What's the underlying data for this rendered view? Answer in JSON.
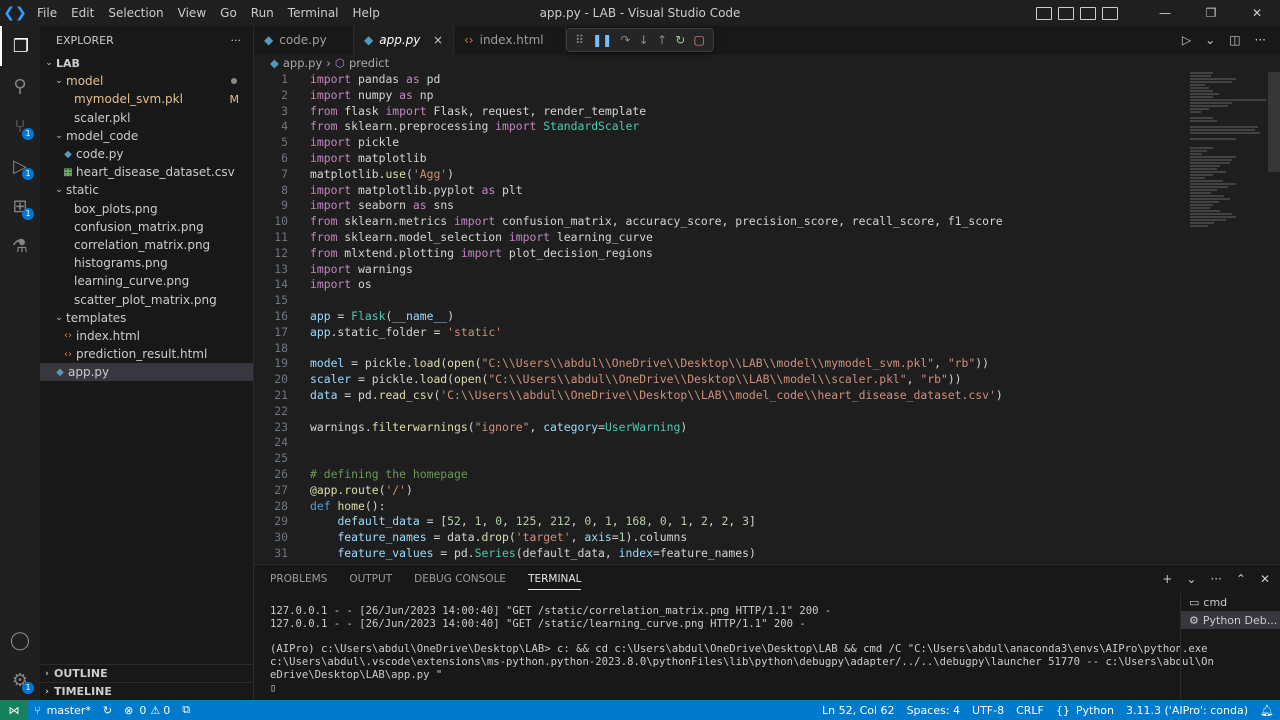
{
  "titlebar": {
    "menu": [
      "File",
      "Edit",
      "Selection",
      "View",
      "Go",
      "Run",
      "Terminal",
      "Help"
    ],
    "title": "app.py - LAB - Visual Studio Code",
    "minimize": "—",
    "maximize": "❐",
    "close": "✕"
  },
  "activity": {
    "scm_badge": "1",
    "debug_badge": "1",
    "ext_badge": "1",
    "settings_badge": "1"
  },
  "explorer": {
    "header": "EXPLORER",
    "more": "···",
    "root": "LAB",
    "folder_model": "model",
    "file_mymodel": "mymodel_svm.pkl",
    "mymodel_status": "M",
    "file_scaler": "scaler.pkl",
    "folder_model_code": "model_code",
    "file_code": "code.py",
    "file_csv": "heart_disease_dataset.csv",
    "folder_static": "static",
    "file_box": "box_plots.png",
    "file_confusion": "confusion_matrix.png",
    "file_correlation": "correlation_matrix.png",
    "file_histograms": "histograms.png",
    "file_learning": "learning_curve.png",
    "file_scatter": "scatter_plot_matrix.png",
    "folder_templates": "templates",
    "file_index": "index.html",
    "file_prediction": "prediction_result.html",
    "file_app": "app.py",
    "outline": "OUTLINE",
    "timeline": "TIMELINE"
  },
  "tabs": {
    "tab1": "code.py",
    "tab2": "app.py",
    "tab3": "index.html",
    "close": "×"
  },
  "breadcrumb": {
    "file": "app.py",
    "symbol": "predict"
  },
  "editor": {
    "lines": [
      {
        "n": "1",
        "h": "<span class='kw'>import</span> pandas <span class='kw'>as</span> pd"
      },
      {
        "n": "2",
        "h": "<span class='kw'>import</span> numpy <span class='kw'>as</span> np"
      },
      {
        "n": "3",
        "h": "<span class='kw'>from</span> flask <span class='kw'>import</span> Flask, request, render_template"
      },
      {
        "n": "4",
        "h": "<span class='kw'>from</span> sklearn.preprocessing <span class='kw'>import</span> <span class='cls'>StandardScaler</span>"
      },
      {
        "n": "5",
        "h": "<span class='kw'>import</span> pickle"
      },
      {
        "n": "6",
        "h": "<span class='kw'>import</span> matplotlib"
      },
      {
        "n": "7",
        "h": "matplotlib.<span class='fn'>use</span>(<span class='str'>'Agg'</span>)"
      },
      {
        "n": "8",
        "h": "<span class='kw'>import</span> matplotlib.pyplot <span class='kw'>as</span> plt"
      },
      {
        "n": "9",
        "h": "<span class='kw'>import</span> seaborn <span class='kw'>as</span> sns"
      },
      {
        "n": "10",
        "h": "<span class='kw'>from</span> sklearn.metrics <span class='kw'>import</span> confusion_matrix, accuracy_score, precision_score, recall_score, f1_score"
      },
      {
        "n": "11",
        "h": "<span class='kw'>from</span> sklearn.model_selection <span class='kw'>import</span> learning_curve"
      },
      {
        "n": "12",
        "h": "<span class='kw'>from</span> mlxtend.plotting <span class='kw'>import</span> plot_decision_regions"
      },
      {
        "n": "13",
        "h": "<span class='kw'>import</span> warnings"
      },
      {
        "n": "14",
        "h": "<span class='kw'>import</span> os"
      },
      {
        "n": "15",
        "h": ""
      },
      {
        "n": "16",
        "h": "<span class='var'>app</span> = <span class='cls'>Flask</span>(<span class='var'>__name__</span>)"
      },
      {
        "n": "17",
        "h": "<span class='var'>app</span>.static_folder = <span class='str'>'static'</span>"
      },
      {
        "n": "18",
        "h": ""
      },
      {
        "n": "19",
        "h": "<span class='var'>model</span> = pickle.<span class='fn'>load</span>(<span class='fn'>open</span>(<span class='str'>\"C:\\\\Users\\\\abdul\\\\OneDrive\\\\Desktop\\\\LAB\\\\model\\\\mymodel_svm.pkl\"</span>, <span class='str'>\"rb\"</span>))"
      },
      {
        "n": "20",
        "h": "<span class='var'>scaler</span> = pickle.<span class='fn'>load</span>(<span class='fn'>open</span>(<span class='str'>\"C:\\\\Users\\\\abdul\\\\OneDrive\\\\Desktop\\\\LAB\\\\model\\\\scaler.pkl\"</span>, <span class='str'>\"rb\"</span>))"
      },
      {
        "n": "21",
        "h": "<span class='var'>data</span> = pd.<span class='fn'>read_csv</span>(<span class='str'>'C:\\\\Users\\\\abdul\\\\OneDrive\\\\Desktop\\\\LAB\\\\model_code\\\\heart_disease_dataset.csv'</span>)"
      },
      {
        "n": "22",
        "h": ""
      },
      {
        "n": "23",
        "h": "warnings.<span class='fn'>filterwarnings</span>(<span class='str'>\"ignore\"</span>, <span class='var'>category</span>=<span class='cls'>UserWarning</span>)"
      },
      {
        "n": "24",
        "h": ""
      },
      {
        "n": "25",
        "h": ""
      },
      {
        "n": "26",
        "h": "<span class='cm'># defining the homepage</span>"
      },
      {
        "n": "27",
        "h": "<span class='fn'>@app.route</span>(<span class='str'>'/'</span>)"
      },
      {
        "n": "28",
        "h": "<span class='kw2'>def</span> <span class='fn'>home</span>():"
      },
      {
        "n": "29",
        "h": "    <span class='var'>default_data</span> = [<span class='num'>52</span>, <span class='num'>1</span>, <span class='num'>0</span>, <span class='num'>125</span>, <span class='num'>212</span>, <span class='num'>0</span>, <span class='num'>1</span>, <span class='num'>168</span>, <span class='num'>0</span>, <span class='num'>1</span>, <span class='num'>2</span>, <span class='num'>2</span>, <span class='num'>3</span>]"
      },
      {
        "n": "30",
        "h": "    <span class='var'>feature_names</span> = data.<span class='fn'>drop</span>(<span class='str'>'target'</span>, <span class='var'>axis</span>=<span class='num'>1</span>).columns"
      },
      {
        "n": "31",
        "h": "    <span class='var'>feature_values</span> = pd.<span class='cls'>Series</span>(default_data, <span class='var'>index</span>=feature_names)"
      }
    ]
  },
  "panel": {
    "tab_problems": "PROBLEMS",
    "tab_output": "OUTPUT",
    "tab_debug": "DEBUG CONSOLE",
    "tab_terminal": "TERMINAL",
    "terminal_text": "127.0.0.1 - - [26/Jun/2023 14:00:40] \"GET /static/correlation_matrix.png HTTP/1.1\" 200 -\n127.0.0.1 - - [26/Jun/2023 14:00:40] \"GET /static/learning_curve.png HTTP/1.1\" 200 -\n\n(AIPro) c:\\Users\\abdul\\OneDrive\\Desktop\\LAB> c: && cd c:\\Users\\abdul\\OneDrive\\Desktop\\LAB && cmd /C \"C:\\Users\\abdul\\anaconda3\\envs\\AIPro\\python.exe\nc:\\Users\\abdul\\.vscode\\extensions\\ms-python.python-2023.8.0\\pythonFiles\\lib\\python\\debugpy\\adapter/../..\\debugpy\\launcher 51770 -- c:\\Users\\abdul\\On\neDrive\\Desktop\\LAB\\app.py \"\n▯",
    "term_cmd": "cmd",
    "term_python": "Python Deb..."
  },
  "status": {
    "branch": "master*",
    "errors": "0",
    "warnings": "0",
    "position": "Ln 52, Col 62",
    "spaces": "Spaces: 4",
    "encoding": "UTF-8",
    "eol": "CRLF",
    "language": "Python",
    "interpreter": "3.11.3 ('AIPro': conda)"
  }
}
